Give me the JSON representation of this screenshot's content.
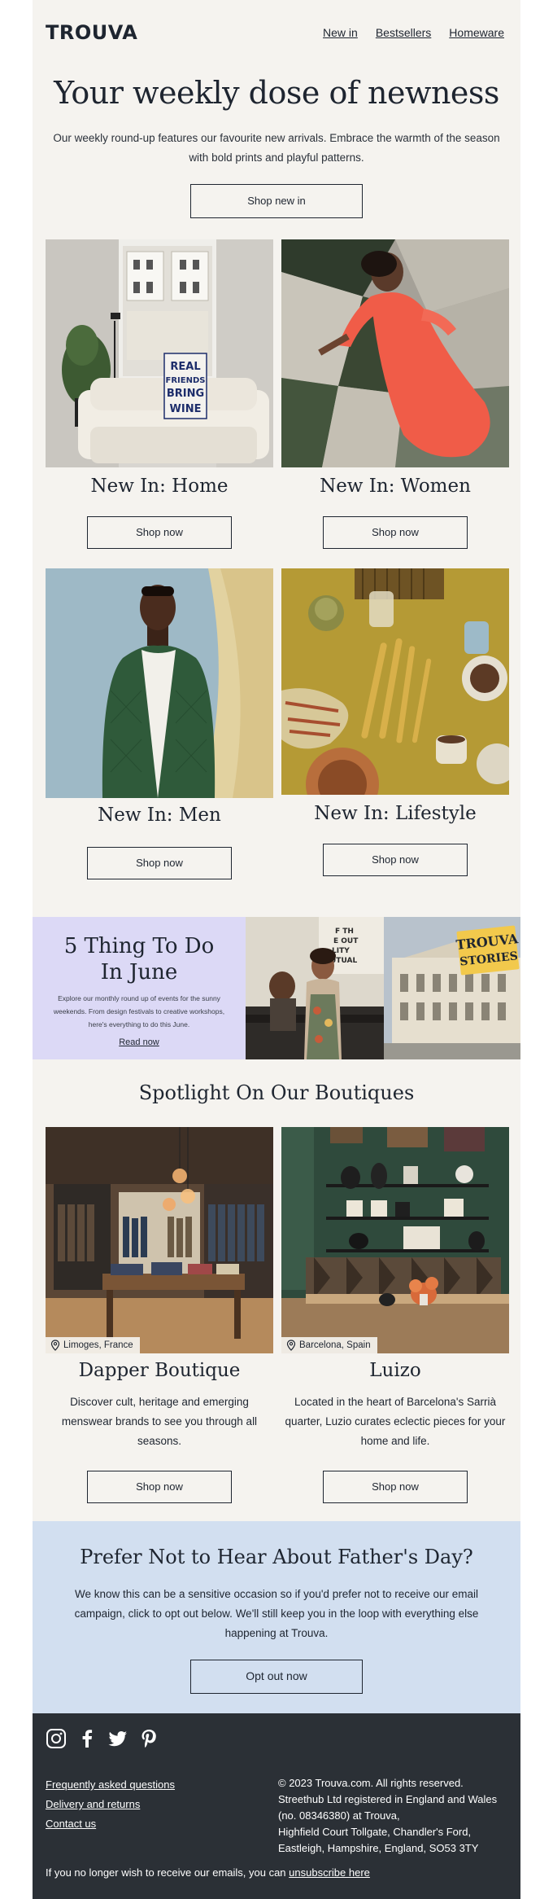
{
  "header": {
    "logo": "TROUVA",
    "nav": [
      "New in",
      "Bestsellers",
      "Homeware"
    ]
  },
  "hero": {
    "title": "Your weekly dose of newness",
    "text": "Our weekly round-up features our favourite new arrivals. Embrace the warmth of the season with bold prints and playful patterns.",
    "button": "Shop new in"
  },
  "products": [
    {
      "title": "New In: Home",
      "button": "Shop now",
      "sign_text": "REAL FRIENDS BRING WINE"
    },
    {
      "title": "New In: Women",
      "button": "Shop now"
    },
    {
      "title": "New In: Men",
      "button": "Shop now"
    },
    {
      "title": "New In: Lifestyle",
      "button": "Shop now"
    }
  ],
  "events": {
    "title_line1": "5 Thing To Do",
    "title_line2": "In June",
    "text": "Explore our monthly round up of events for the sunny weekends. From design festivals to creative workshops, here's everything to do this June.",
    "link": "Read now",
    "badge_line1": "TROUVA",
    "badge_line2": "STORIES"
  },
  "boutiques": {
    "title": "Spotlight On Our Boutiques",
    "items": [
      {
        "name": "Dapper Boutique",
        "location": "Limoges, France",
        "desc": "Discover cult, heritage and emerging menswear brands to see you through all seasons.",
        "button": "Shop now"
      },
      {
        "name": "Luizo",
        "location": "Barcelona, Spain",
        "desc": "Located in the heart of Barcelona's Sarrià quarter, Luzio curates eclectic pieces for your home and life.",
        "button": "Shop now"
      }
    ]
  },
  "optout": {
    "title": "Prefer Not to Hear About Father's Day?",
    "text": "We know this can be a sensitive occasion so if you'd prefer not to receive our email campaign, click to opt out below. We'll still keep you in the loop with everything else happening at Trouva.",
    "button": "Opt out now"
  },
  "footer": {
    "social": [
      "instagram-icon",
      "facebook-icon",
      "twitter-icon",
      "pinterest-icon"
    ],
    "links": [
      "Frequently asked questions",
      "Delivery and returns",
      "Contact us"
    ],
    "copyright_lines": [
      "© 2023 Trouva.com. All rights reserved.",
      "Streethub Ltd registered in England and Wales",
      "(no. 08346380) at Trouva,",
      "Highfield Court Tollgate, Chandler's Ford,",
      "Eastleigh, Hampshire, England, SO53 3TY"
    ],
    "unsub_text": "If you no longer wish to receive our emails, you can",
    "unsub_link": "unsubscribe here"
  },
  "colors": {
    "page_bg": "#f5f3ef",
    "ink": "#1e2530",
    "events_bg": "#dcd9f6",
    "optout_bg": "#d2dff0",
    "footer_bg": "#2b3036"
  }
}
